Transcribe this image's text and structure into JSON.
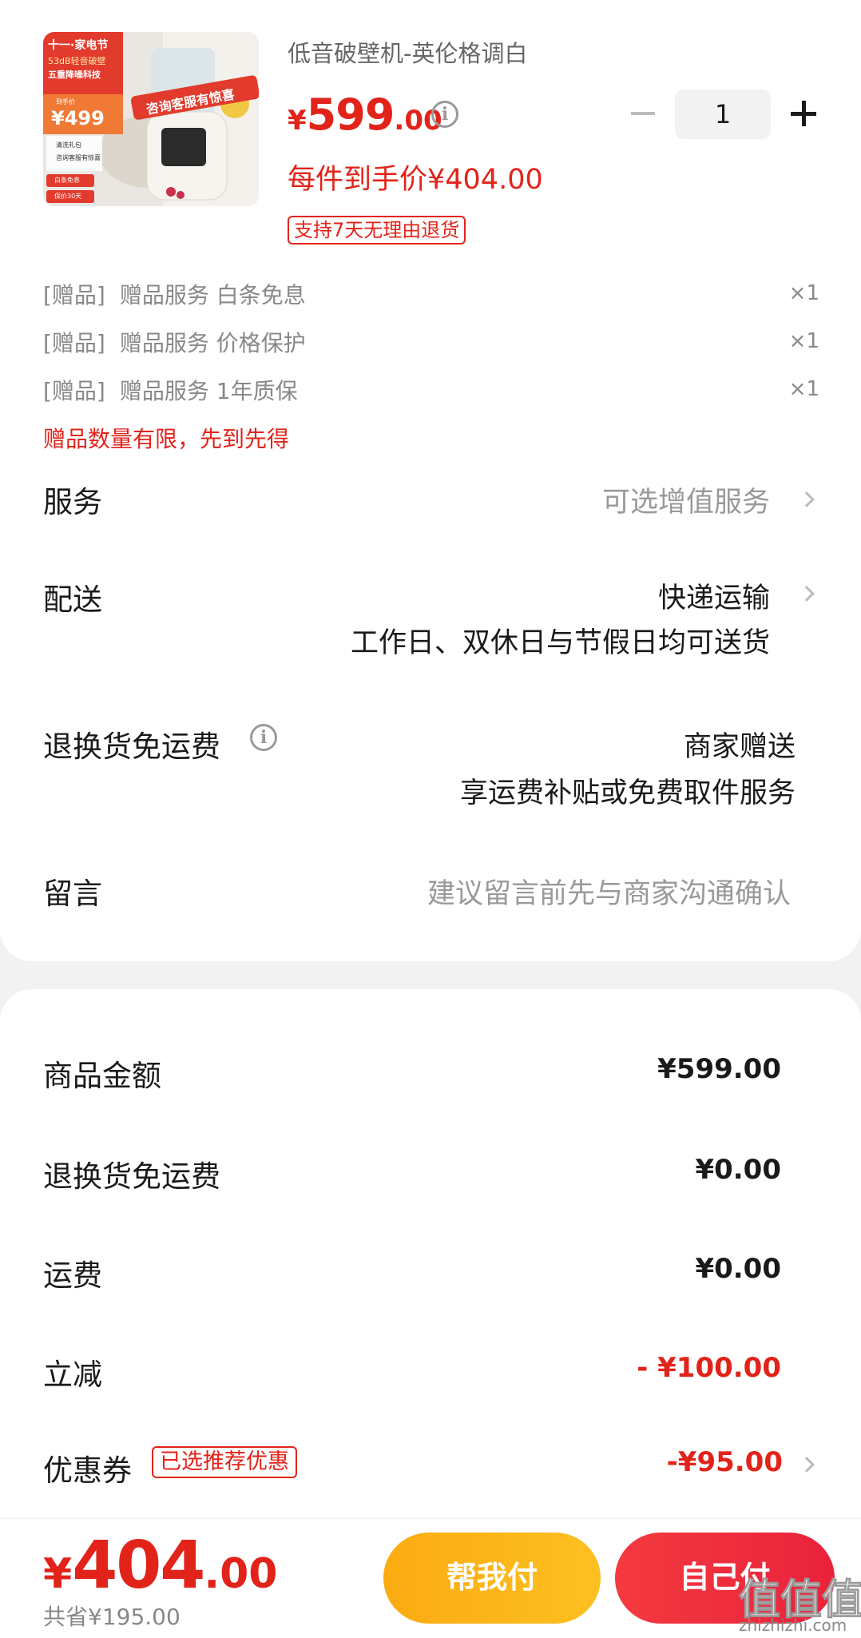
{
  "product": {
    "title": "低音破壁机-英伦格调白",
    "price_currency": "¥",
    "price_int": "599",
    "price_dec": ".00",
    "quantity": "1",
    "unit_price": "每件到手价¥404.00",
    "return_badge": "支持7天无理由退货",
    "image": {
      "banner_top": "十一·家电节",
      "banner_line2": "53dB轻音破壁",
      "banner_line3": "五重降噪科技",
      "price_tag": "¥499",
      "price_tag_label": "到手价",
      "promo": "咨询客服有惊喜",
      "side1": "清洗礼包",
      "side2": "咨询客服有惊喜",
      "bottom1": "白条免息",
      "bottom2": "保价30天"
    }
  },
  "gifts": {
    "items": [
      {
        "tag": "[赠品]",
        "name": "赠品服务 白条免息",
        "count": "×1"
      },
      {
        "tag": "[赠品]",
        "name": "赠品服务 价格保护",
        "count": "×1"
      },
      {
        "tag": "[赠品]",
        "name": "赠品服务 1年质保",
        "count": "×1"
      }
    ],
    "note": "赠品数量有限，先到先得"
  },
  "service": {
    "label": "服务",
    "value": "可选增值服务"
  },
  "delivery": {
    "label": "配送",
    "method": "快递运输",
    "detail": "工作日、双休日与节假日均可送货"
  },
  "return_shipping": {
    "label": "退换货免运费",
    "value": "商家赠送",
    "detail": "享运费补贴或免费取件服务"
  },
  "message": {
    "label": "留言",
    "placeholder": "建议留言前先与商家沟通确认"
  },
  "summary": {
    "goods_label": "商品金额",
    "goods_value": "¥599.00",
    "return_label": "退换货免运费",
    "return_value": "¥0.00",
    "shipping_label": "运费",
    "shipping_value": "¥0.00",
    "discount_label": "立减",
    "discount_value": "- ¥100.00",
    "coupon_label": "优惠券",
    "coupon_badge": "已选推荐优惠",
    "coupon_value": "-¥95.00"
  },
  "checkout": {
    "total_currency": "¥",
    "total_int": "404",
    "total_dec": ".00",
    "saved": "共省¥195.00",
    "help_pay": "帮我付",
    "self_pay": "自己付"
  },
  "watermark": {
    "text": "值值值",
    "sub": "zhizhizhi.com"
  },
  "colors": {
    "accent_red": "#e2231a",
    "help_btn": "#fcb51a",
    "self_btn": "#ee2d3e"
  }
}
